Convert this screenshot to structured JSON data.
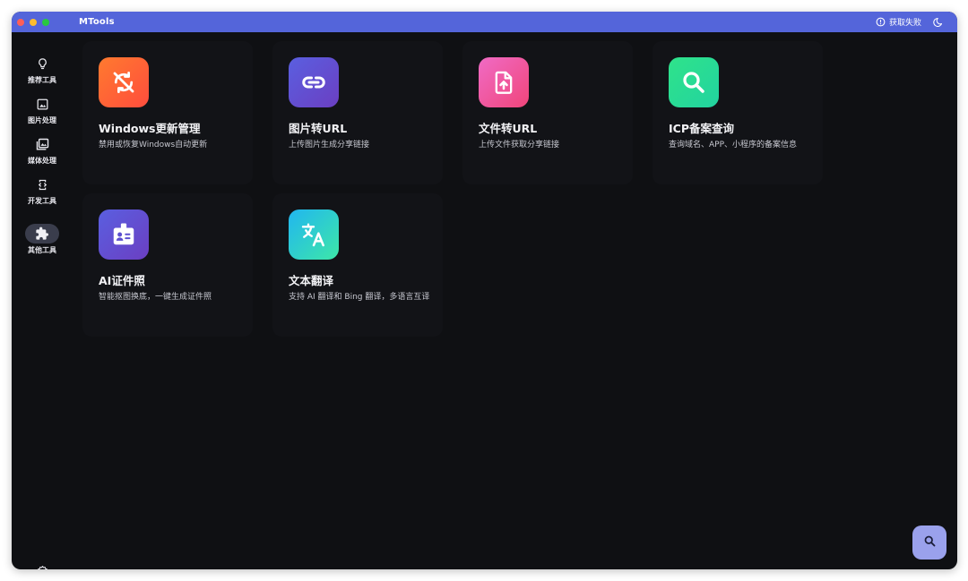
{
  "window": {
    "title": "MTools",
    "status_text": "获取失败"
  },
  "sidebar": {
    "items": [
      {
        "label": "推荐工具",
        "icon": "lightbulb-icon",
        "active": false
      },
      {
        "label": "图片处理",
        "icon": "image-icon",
        "active": false
      },
      {
        "label": "媒体处理",
        "icon": "photo-library-icon",
        "active": false
      },
      {
        "label": "开发工具",
        "icon": "developer-mode-icon",
        "active": false
      },
      {
        "label": "其他工具",
        "icon": "puzzle-icon",
        "active": true
      }
    ],
    "settings_icon": "gear-icon"
  },
  "tools": [
    {
      "title": "Windows更新管理",
      "description": "禁用或恢复Windows自动更新",
      "icon": "update-disabled-icon",
      "gradient": [
        "#ff7a2f",
        "#ff4d3d"
      ]
    },
    {
      "title": "图片转URL",
      "description": "上传图片生成分享链接",
      "icon": "link-icon",
      "gradient": [
        "#5a5fe0",
        "#6b3fc2"
      ]
    },
    {
      "title": "文件转URL",
      "description": "上传文件获取分享链接",
      "icon": "file-upload-icon",
      "gradient": [
        "#f06bc5",
        "#f0457a"
      ]
    },
    {
      "title": "ICP备案查询",
      "description": "查询域名、APP、小程序的备案信息",
      "icon": "search-icon",
      "gradient": [
        "#2fe38a",
        "#22d3a0"
      ]
    },
    {
      "title": "AI证件照",
      "description": "智能抠图换底，一键生成证件照",
      "icon": "id-badge-icon",
      "gradient": [
        "#5a5fe0",
        "#6b3fc2"
      ]
    },
    {
      "title": "文本翻译",
      "description": "支持 AI 翻译和 Bing 翻译，多语言互译",
      "icon": "translate-icon",
      "gradient": [
        "#21b6f0",
        "#3de7a8"
      ]
    }
  ],
  "fab": {
    "icon": "search-icon"
  },
  "colors": {
    "titlebar": "#5465da",
    "background": "#0f1013",
    "card": "#121317",
    "fab": "#9aa1ec"
  }
}
